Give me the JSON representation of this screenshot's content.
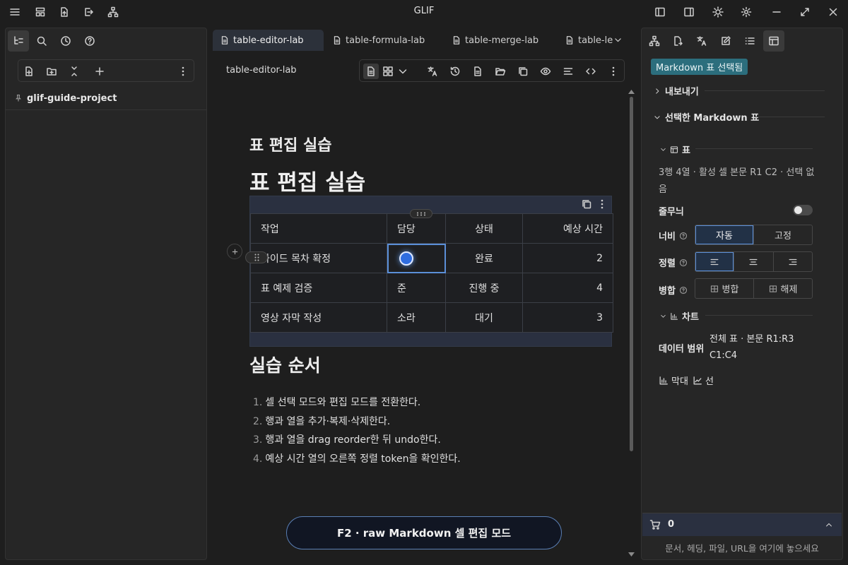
{
  "app": {
    "title": "GLIF"
  },
  "left": {
    "vault_name": "glif-guide-project"
  },
  "tabs": [
    {
      "label": "table-editor-lab"
    },
    {
      "label": "table-formula-lab"
    },
    {
      "label": "table-merge-lab"
    },
    {
      "label": "table-le"
    }
  ],
  "view": {
    "breadcrumb": "table-editor-lab"
  },
  "doc": {
    "h3": "표 편집 실습",
    "h1": "표 편집 실습",
    "table": {
      "headers": [
        "작업",
        "담당",
        "상태",
        "예상 시간"
      ],
      "rows": [
        [
          "가이드 목차 확정",
          "",
          "완료",
          "2"
        ],
        [
          "표 예제 검증",
          "준",
          "진행 중",
          "4"
        ],
        [
          "영상 자막 작성",
          "소라",
          "대기",
          "3"
        ]
      ]
    },
    "h2": "실습 순서",
    "steps": [
      "셀 선택 모드와 편집 모드를 전환한다.",
      "행과 열을 추가·복제·삭제한다.",
      "행과 열을 drag reorder한 뒤 undo한다.",
      "예상 시간 열의 오른쪽 정렬 token을 확인한다."
    ],
    "mode_button": "F2 · raw Markdown 셀 편집 모드"
  },
  "right": {
    "badge": "Markdown 표 선택됨",
    "export_section": "내보내기",
    "selected_section": "선택한 Markdown 표",
    "table_sub": "표",
    "table_info": "3행 4열 · 활성 셀 본문 R1 C2 · 선택 없음",
    "zebra_label": "줄무늬",
    "width_label": "너비",
    "width_options": [
      "자동",
      "고정"
    ],
    "align_label": "정렬",
    "merge_label": "병합",
    "merge_options": [
      "병합",
      "해제"
    ],
    "chart_sub": "차트",
    "range_label": "데이터 범위",
    "range_value": "전체 표 · 본문 R1:R3 C1:C4",
    "chart_types": [
      "막대",
      "선"
    ],
    "cart_count": "0",
    "drop_hint": "문서, 헤딩, 파일, URL을 여기에 놓으세요"
  }
}
